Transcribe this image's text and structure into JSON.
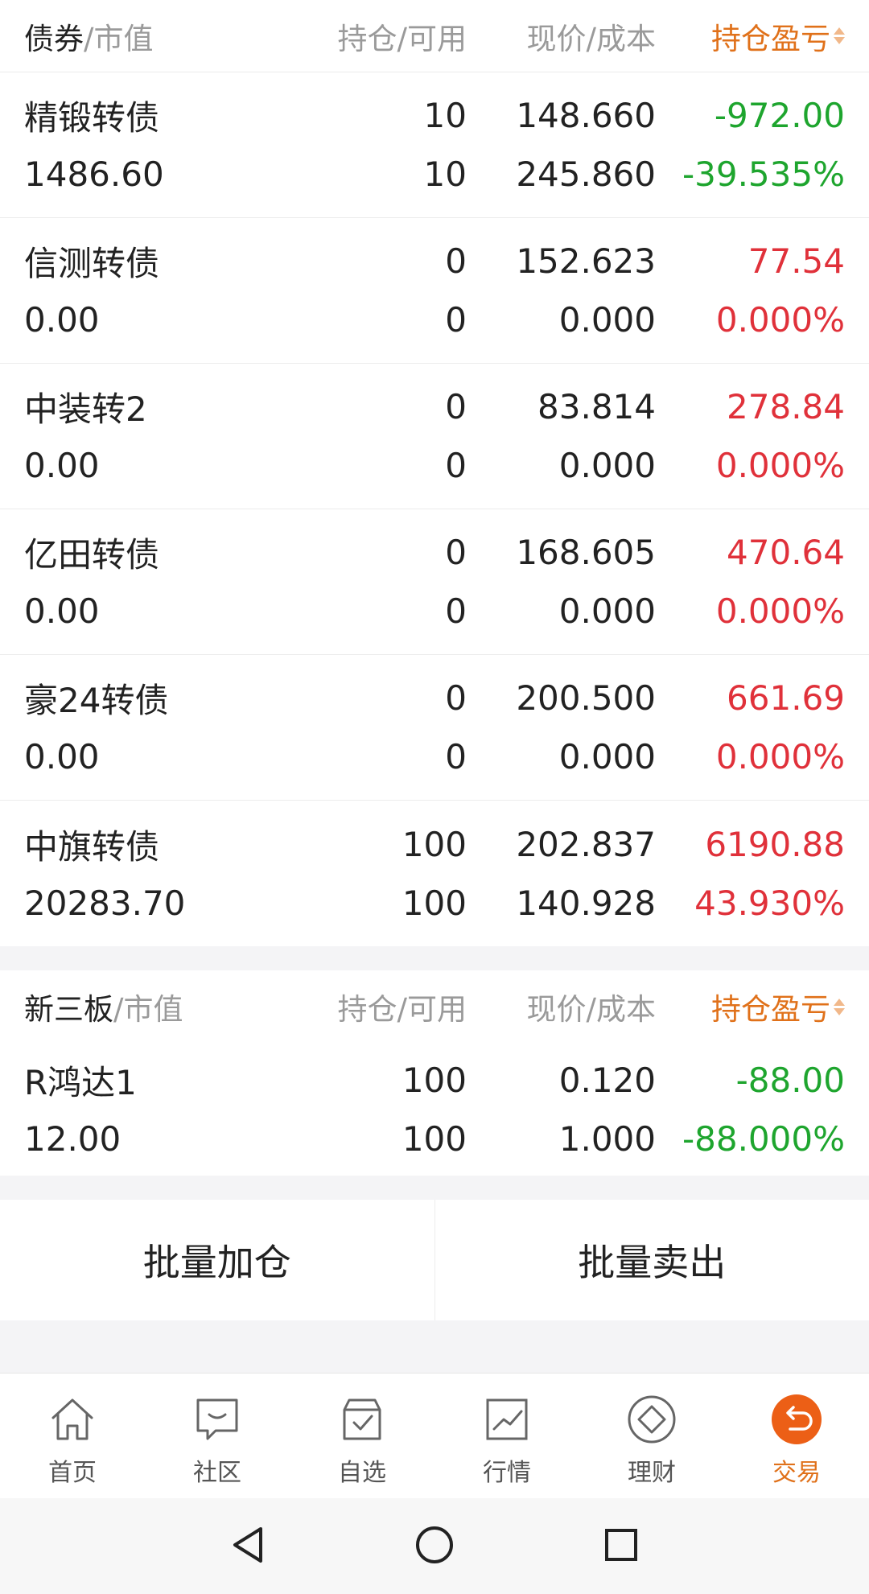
{
  "bonds": {
    "header": {
      "name": "债券",
      "name_sub": "/市值",
      "qty": "持仓/可用",
      "price": "现价/成本",
      "pnl": "持仓盈亏"
    },
    "rows": [
      {
        "name": "精锻转债",
        "market_value": "1486.60",
        "holding": "10",
        "available": "10",
        "price": "148.660",
        "cost": "245.860",
        "pnl": "-972.00",
        "pnl_pct": "-39.535%"
      },
      {
        "name": "信测转债",
        "market_value": "0.00",
        "holding": "0",
        "available": "0",
        "price": "152.623",
        "cost": "0.000",
        "pnl": "77.54",
        "pnl_pct": "0.000%"
      },
      {
        "name": "中装转2",
        "market_value": "0.00",
        "holding": "0",
        "available": "0",
        "price": "83.814",
        "cost": "0.000",
        "pnl": "278.84",
        "pnl_pct": "0.000%"
      },
      {
        "name": "亿田转债",
        "market_value": "0.00",
        "holding": "0",
        "available": "0",
        "price": "168.605",
        "cost": "0.000",
        "pnl": "470.64",
        "pnl_pct": "0.000%"
      },
      {
        "name": "豪24转债",
        "market_value": "0.00",
        "holding": "0",
        "available": "0",
        "price": "200.500",
        "cost": "0.000",
        "pnl": "661.69",
        "pnl_pct": "0.000%"
      },
      {
        "name": "中旗转债",
        "market_value": "20283.70",
        "holding": "100",
        "available": "100",
        "price": "202.837",
        "cost": "140.928",
        "pnl": "6190.88",
        "pnl_pct": "43.930%"
      }
    ]
  },
  "neeq": {
    "header": {
      "name": "新三板",
      "name_sub": "/市值",
      "qty": "持仓/可用",
      "price": "现价/成本",
      "pnl": "持仓盈亏"
    },
    "rows": [
      {
        "name": "R鸿达1",
        "market_value": "12.00",
        "holding": "100",
        "available": "100",
        "price": "0.120",
        "cost": "1.000",
        "pnl": "-88.00",
        "pnl_pct": "-88.000%"
      }
    ]
  },
  "actions": {
    "batch_add": "批量加仓",
    "batch_sell": "批量卖出"
  },
  "tabs": [
    {
      "label": "首页",
      "icon": "home-icon"
    },
    {
      "label": "社区",
      "icon": "chat-icon"
    },
    {
      "label": "自选",
      "icon": "watchlist-icon"
    },
    {
      "label": "行情",
      "icon": "chart-icon"
    },
    {
      "label": "理财",
      "icon": "diamond-icon"
    },
    {
      "label": "交易",
      "icon": "trade-icon",
      "active": true
    }
  ],
  "colors": {
    "accent": "#e0711a",
    "up": "#e0313a",
    "down": "#1ea52e"
  }
}
